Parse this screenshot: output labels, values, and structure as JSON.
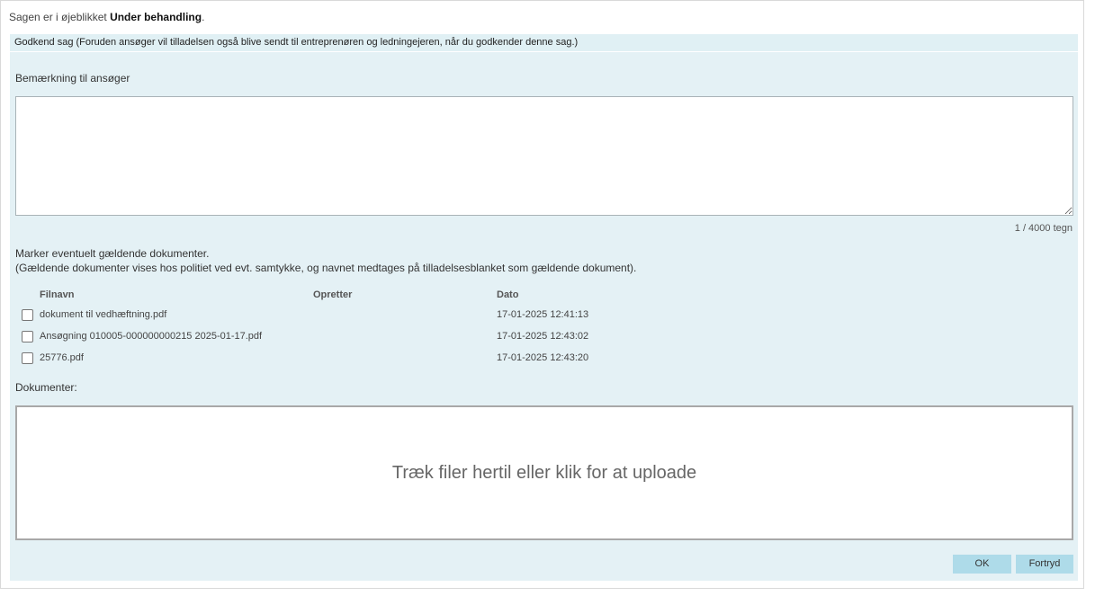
{
  "status": {
    "prefix": "Sagen er i øjeblikket ",
    "state": "Under behandling",
    "suffix": "."
  },
  "panel_header": "Godkend sag (Foruden ansøger vil tilladelsen også blive sendt til entreprenøren og ledningejeren, når du godkender denne sag.)",
  "remark": {
    "label": "Bemærkning til ansøger",
    "value": "",
    "counter": "1 / 4000 tegn"
  },
  "documents_instruction": {
    "line1": "Marker eventuelt gældende dokumenter.",
    "line2": "(Gældende dokumenter vises hos politiet ved evt. samtykke, og navnet medtages på tilladelsesblanket som gældende dokument)."
  },
  "table": {
    "headers": {
      "filename": "Filnavn",
      "creator": "Opretter",
      "date": "Dato"
    },
    "rows": [
      {
        "filename": "dokument til vedhæftning.pdf",
        "creator": "",
        "date": "17-01-2025 12:41:13",
        "checked": false
      },
      {
        "filename": "Ansøgning 010005-000000000215 2025-01-17.pdf",
        "creator": "",
        "date": "17-01-2025 12:43:02",
        "checked": false
      },
      {
        "filename": "25776.pdf",
        "creator": "",
        "date": "17-01-2025 12:43:20",
        "checked": false
      }
    ]
  },
  "upload": {
    "label": "Dokumenter:",
    "dropzone_text": "Træk filer hertil eller klik for at uploade"
  },
  "buttons": {
    "ok": "OK",
    "cancel": "Fortryd"
  },
  "colors": {
    "panel_bg": "#e4f1f5",
    "button_bg": "#aedbe9"
  }
}
